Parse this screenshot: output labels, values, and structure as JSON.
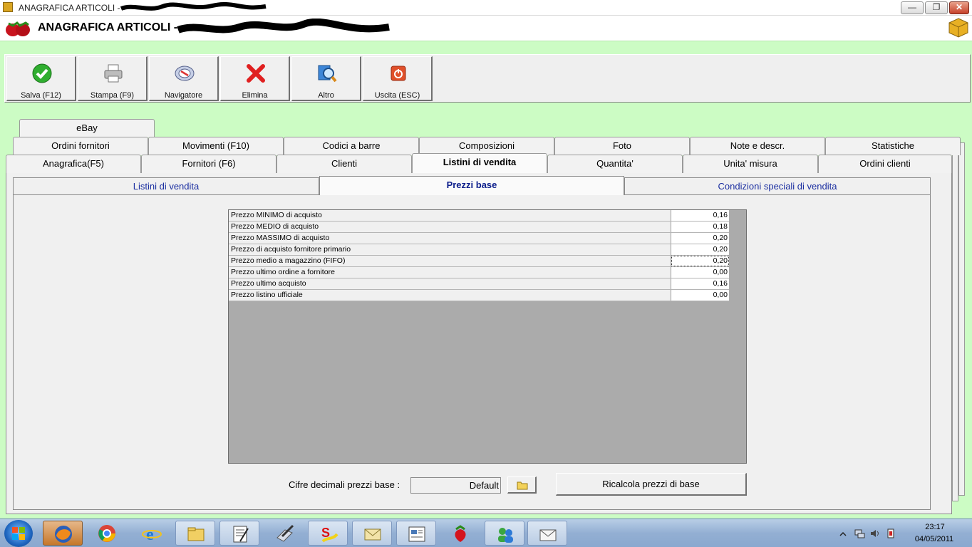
{
  "window": {
    "title": "ANAGRAFICA ARTICOLI -",
    "header_title": "ANAGRAFICA ARTICOLI -",
    "controls": {
      "minimize": "—",
      "maximize": "❐",
      "close": "✕"
    }
  },
  "toolbar": {
    "buttons": [
      {
        "label": "Salva (F12)",
        "icon": "checkmark-icon"
      },
      {
        "label": "Stampa (F9)",
        "icon": "printer-icon"
      },
      {
        "label": "Navigatore",
        "icon": "compass-icon"
      },
      {
        "label": "Elimina",
        "icon": "delete-x-icon"
      },
      {
        "label": "Altro",
        "icon": "search-icon"
      },
      {
        "label": "Uscita (ESC)",
        "icon": "power-icon"
      }
    ]
  },
  "tabs": {
    "row3": [
      "eBay"
    ],
    "row2": [
      "Ordini fornitori",
      "Movimenti (F10)",
      "Codici a barre",
      "Composizioni",
      "Foto",
      "Note e descr.",
      "Statistiche"
    ],
    "row1": [
      "Anagrafica(F5)",
      "Fornitori (F6)",
      "Clienti",
      "Listini di vendita",
      "Quantita'",
      "Unita' misura",
      "Ordini clienti"
    ],
    "active": "Listini di vendita"
  },
  "subtabs": {
    "items": [
      "Listini di vendita",
      "Prezzi base",
      "Condizioni speciali di vendita"
    ],
    "active": "Prezzi base"
  },
  "prices": {
    "rows": [
      {
        "label": "Prezzo MINIMO di acquisto",
        "value": "0,16"
      },
      {
        "label": "Prezzo MEDIO di acquisto",
        "value": "0,18"
      },
      {
        "label": "Prezzo MASSIMO di acquisto",
        "value": "0,20"
      },
      {
        "label": "Prezzo di acquisto fornitore primario",
        "value": "0,20"
      },
      {
        "label": "Prezzo medio a magazzino (FIFO)",
        "value": "0,20"
      },
      {
        "label": "Prezzo ultimo ordine a fornitore",
        "value": "0,00"
      },
      {
        "label": "Prezzo ultimo acquisto",
        "value": "0,16"
      },
      {
        "label": "Prezzo listino ufficiale",
        "value": "0,00"
      }
    ]
  },
  "bottom": {
    "cifre_label": "Cifre decimali prezzi base :",
    "cifre_value": "Default",
    "ricalcola_label": "Ricalcola prezzi di base"
  },
  "taskbar": {
    "time": "23:17",
    "date": "04/05/2011",
    "apps": [
      "firefox-icon",
      "chrome-icon",
      "internet-explorer-icon",
      "file-explorer-icon",
      "notepad-icon",
      "paint-icon",
      "solitaire-icon",
      "mail-icon",
      "news-icon",
      "strawberry-icon",
      "messenger-icon",
      "envelope-icon"
    ]
  },
  "colors": {
    "background": "#ccfcc4",
    "grid_bg": "#ababab",
    "tab_link": "#1a2ea0"
  }
}
